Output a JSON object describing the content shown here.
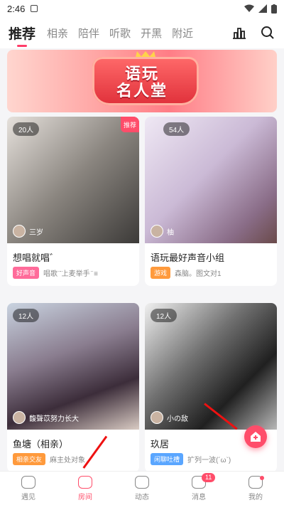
{
  "status": {
    "time": "2:46"
  },
  "topnav": {
    "tabs": [
      "推荐",
      "相亲",
      "陪伴",
      "听歌",
      "开黑",
      "附近"
    ],
    "active_tab": 0
  },
  "banner": {
    "line1": "语玩",
    "line2": "名人堂"
  },
  "cards": [
    {
      "count": "20人",
      "badge": "推荐",
      "host": "三岁",
      "title": "想唱就唱゛",
      "tag": "好声音",
      "desc": "唱歌 ̈ ̈上麦举手 ̈ ≡"
    },
    {
      "count": "54人",
      "badge": "",
      "host": "柚",
      "title": "语玩最好声音小组",
      "tag": "游戏",
      "desc": "森脑。图文对1"
    },
    {
      "count": "12人",
      "badge": "",
      "host": "馥聲苡努力长大",
      "title": "鱼塘（相亲）",
      "tag": "相亲交友",
      "desc": "麻主处对象"
    },
    {
      "count": "12人",
      "badge": "",
      "host": "小の敌",
      "title": "玖居",
      "tag": "闲聊吐槽",
      "desc": "扩列一波(´ω`)"
    }
  ],
  "bottomnav": [
    {
      "label": "遇见",
      "badge": ""
    },
    {
      "label": "房间",
      "badge": ""
    },
    {
      "label": "动态",
      "badge": ""
    },
    {
      "label": "消息",
      "badge": "11"
    },
    {
      "label": "我的",
      "badge": ""
    }
  ]
}
